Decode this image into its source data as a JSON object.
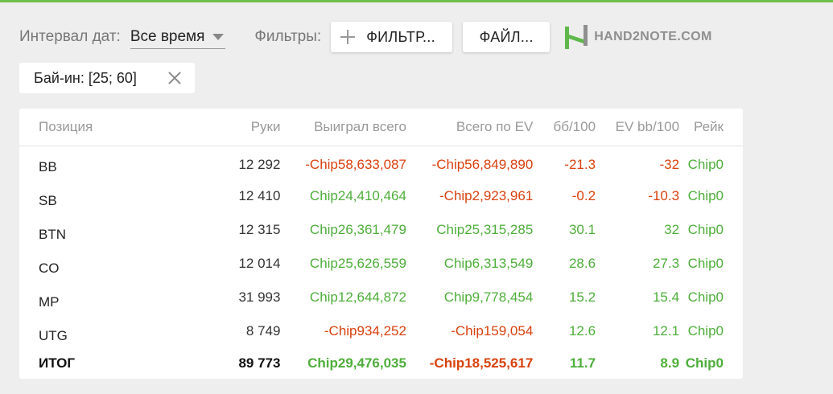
{
  "controls": {
    "date_label": "Интервал дат:",
    "date_value": "Все время",
    "filters_label": "Фильтры:",
    "add_filter_label": "ФИЛЬТР...",
    "file_label": "ФАЙЛ...",
    "logo_text": "HAND2NOTE.COM"
  },
  "active_filter": {
    "label": "Бай-ин: [25; 60]"
  },
  "table": {
    "headers": {
      "position": "Позиция",
      "hands": "Руки",
      "won_total": "Выиграл всего",
      "ev_total": "Всего по EV",
      "bb100": "бб/100",
      "ev_bb100": "EV bb/100",
      "rake": "Рейк"
    },
    "rows": [
      {
        "position": "BB",
        "hands": "12 292",
        "won_total": "-Chip58,633,087",
        "ev_total": "-Chip56,849,890",
        "bb100": "-21.3",
        "ev_bb100": "-32",
        "rake": "Chip0"
      },
      {
        "position": "SB",
        "hands": "12 410",
        "won_total": "Chip24,410,464",
        "ev_total": "-Chip2,923,961",
        "bb100": "-0.2",
        "ev_bb100": "-10.3",
        "rake": "Chip0"
      },
      {
        "position": "BTN",
        "hands": "12 315",
        "won_total": "Chip26,361,479",
        "ev_total": "Chip25,315,285",
        "bb100": "30.1",
        "ev_bb100": "32",
        "rake": "Chip0"
      },
      {
        "position": "CO",
        "hands": "12 014",
        "won_total": "Chip25,626,559",
        "ev_total": "Chip6,313,549",
        "bb100": "28.6",
        "ev_bb100": "27.3",
        "rake": "Chip0"
      },
      {
        "position": "MP",
        "hands": "31 993",
        "won_total": "Chip12,644,872",
        "ev_total": "Chip9,778,454",
        "bb100": "15.2",
        "ev_bb100": "15.4",
        "rake": "Chip0"
      },
      {
        "position": "UTG",
        "hands": "8 749",
        "won_total": "-Chip934,252",
        "ev_total": "-Chip159,054",
        "bb100": "12.6",
        "ev_bb100": "12.1",
        "rake": "Chip0"
      }
    ],
    "total": {
      "position": "ИТОГ",
      "hands": "89 773",
      "won_total": "Chip29,476,035",
      "ev_total": "-Chip18,525,617",
      "bb100": "11.7",
      "ev_bb100": "8.9",
      "rake": "Chip0"
    }
  },
  "colors": {
    "accent": "#6fbf4a",
    "positive": "#4eae3a",
    "negative": "#d9410e"
  }
}
